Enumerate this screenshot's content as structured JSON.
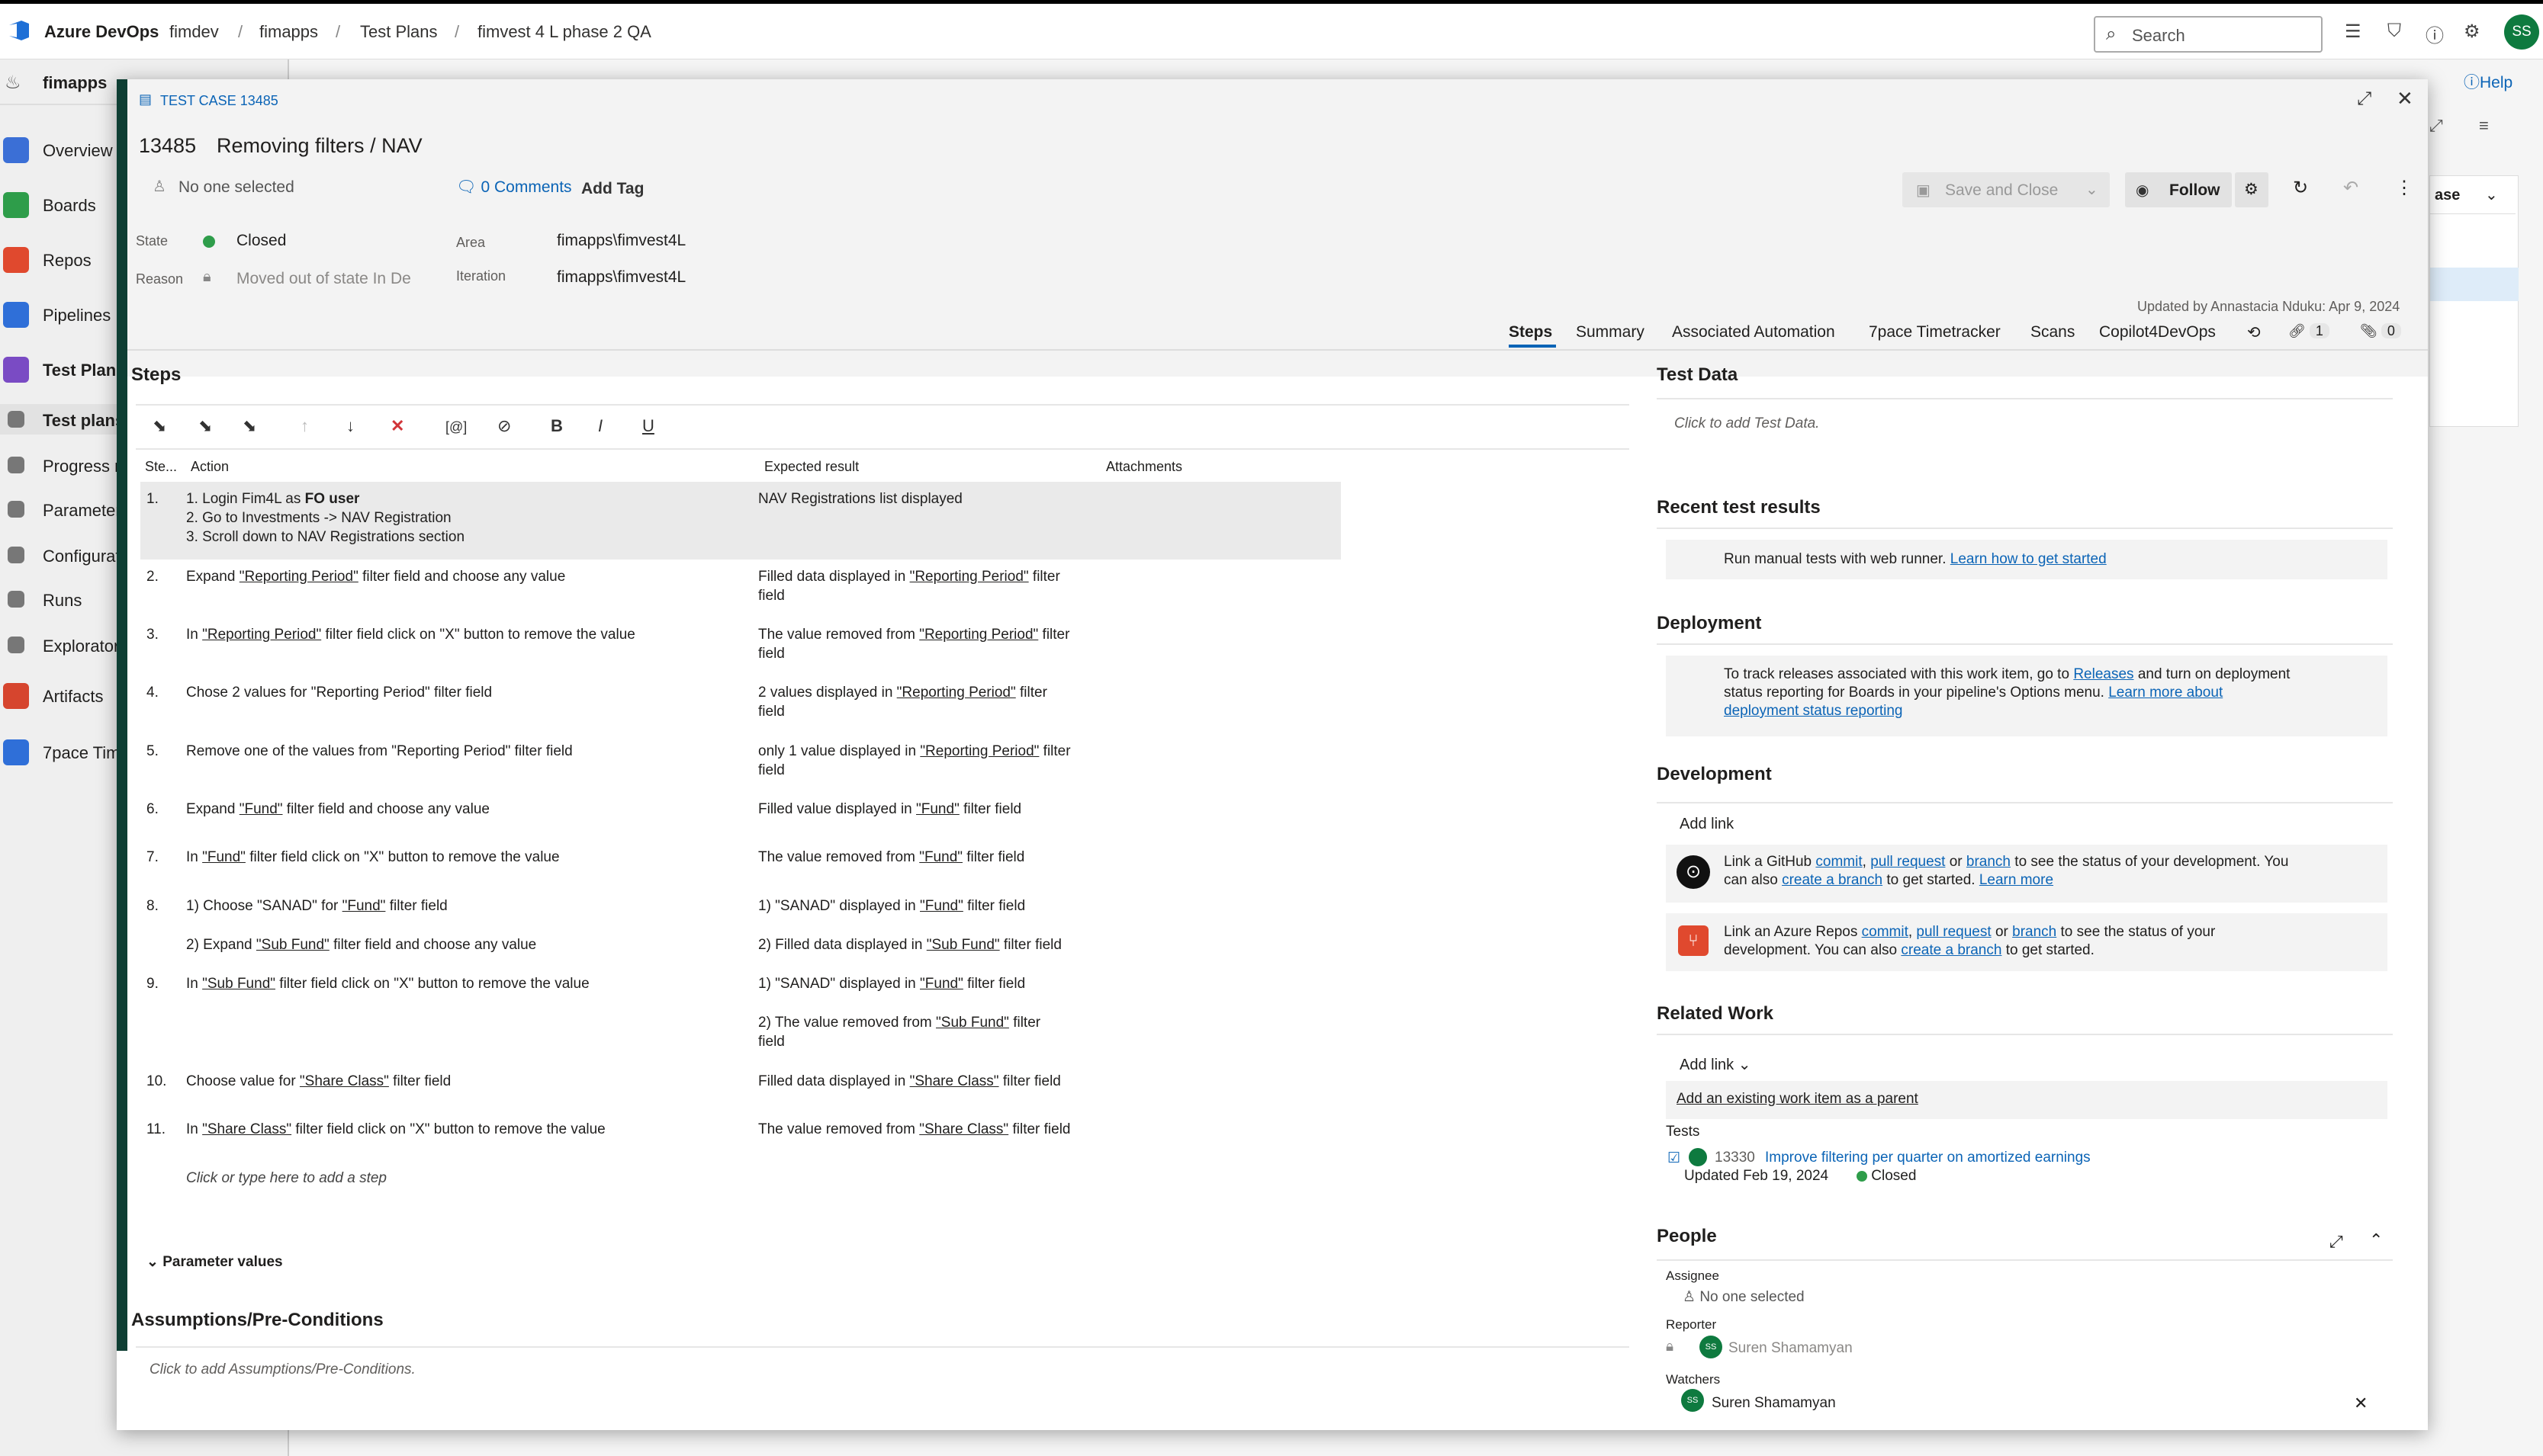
{
  "topbar": {
    "brand": "Azure DevOps",
    "breadcrumb": [
      "fimdev",
      "fimapps",
      "Test Plans",
      "fimvest 4 L phase 2 QA"
    ],
    "search_placeholder": "Search",
    "avatar": "SS"
  },
  "sidebar": {
    "project": "fimapps",
    "items": [
      {
        "label": "Overview",
        "color": "#3b6fd6"
      },
      {
        "label": "Boards",
        "color": "#2e9d4a"
      },
      {
        "label": "Repos",
        "color": "#e0492e"
      },
      {
        "label": "Pipelines",
        "color": "#2f6fd8"
      },
      {
        "label": "Test Plans",
        "color": "#7a4bc4"
      },
      {
        "label": "Test plans",
        "color": "#777777"
      },
      {
        "label": "Progress r",
        "color": "#777777"
      },
      {
        "label": "Parameter",
        "color": "#777777"
      },
      {
        "label": "Configurati",
        "color": "#777777"
      },
      {
        "label": "Runs",
        "color": "#777777"
      },
      {
        "label": "Explorator",
        "color": "#777777"
      },
      {
        "label": "Artifacts",
        "color": "#d6452e"
      },
      {
        "label": "7pace Tim",
        "color": "#2f6fd8"
      }
    ]
  },
  "background": {
    "help": "Help",
    "case_btn": "ase"
  },
  "workitem": {
    "type_label": "TEST CASE 13485",
    "id": "13485",
    "title": "Removing filters / NAV",
    "assignee": "No one selected",
    "comments": "0 Comments",
    "add_tag": "Add Tag",
    "save_close": "Save and Close",
    "follow": "Follow",
    "state_label": "State",
    "state_value": "Closed",
    "reason_label": "Reason",
    "reason_value": "Moved out of state In De",
    "area_label": "Area",
    "area_value": "fimapps\\fimvest4L",
    "iteration_label": "Iteration",
    "iteration_value": "fimapps\\fimvest4L",
    "updated_by": "Updated by Annastacia Nduku: Apr 9, 2024",
    "tabs": [
      "Steps",
      "Summary",
      "Associated Automation",
      "7pace Timetracker",
      "Scans",
      "Copilot4DevOps"
    ],
    "links_count": "1",
    "attachments_count": "0"
  },
  "steps": {
    "title": "Steps",
    "col_step": "Ste...",
    "col_action": "Action",
    "col_expected": "Expected result",
    "col_attachments": "Attachments",
    "add_step": "Click or type here to add a step",
    "parameter_values": "Parameter values"
  },
  "preconditions": {
    "title": "Assumptions/Pre-Conditions",
    "placeholder": "Click to add Assumptions/Pre-Conditions."
  },
  "right": {
    "test_data_title": "Test Data",
    "test_data_placeholder": "Click to add Test Data.",
    "recent_title": "Recent test results",
    "recent_text": "Run manual tests with web runner.",
    "recent_link": "Learn how to get started",
    "deployment_title": "Deployment",
    "deploy_text_1": "To track releases associated with this work item, go to",
    "deploy_releases": "Releases",
    "deploy_text_2": "and turn on deployment",
    "deploy_text_3": "status reporting for Boards in your pipeline's Options menu.",
    "deploy_learn_1": "Learn more about",
    "deploy_learn_2": "deployment status reporting",
    "development_title": "Development",
    "add_link": "Add link",
    "gh_1": "Link a GitHub",
    "gh_commit": "commit",
    "gh_pr": "pull request",
    "gh_or": "or",
    "gh_branch": "branch",
    "gh_2": "to see the status of your development. You",
    "gh_3": "can also",
    "gh_create": "create a branch",
    "gh_4": "to get started.",
    "gh_learn": "Learn more",
    "az_1": "Link an Azure Repos",
    "az_2": "to see the status of your",
    "az_3": "development. You can also",
    "az_4": "to get started.",
    "related_title": "Related Work",
    "related_add_link": "Add link",
    "related_parent": "Add an existing work item as a parent",
    "tests_label": "Tests",
    "test_item_id": "13330",
    "test_item_title": "Improve filtering per quarter on amortized earnings",
    "test_item_updated": "Updated Feb 19, 2024",
    "test_item_state": "Closed",
    "people_title": "People",
    "assignee_label": "Assignee",
    "assignee_value": "No one selected",
    "reporter_label": "Reporter",
    "reporter_value": "Suren Shamamyan",
    "watchers_label": "Watchers",
    "watcher_value": "Suren Shamamyan",
    "avatar_initials": "SS"
  }
}
